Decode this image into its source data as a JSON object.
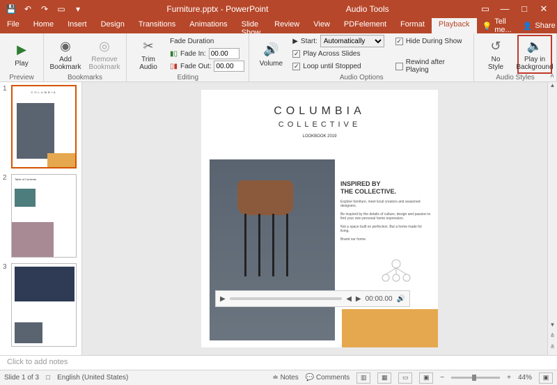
{
  "titlebar": {
    "doc_title": "Furniture.pptx - PowerPoint",
    "audio_tools": "Audio Tools"
  },
  "tabs": {
    "file": "File",
    "home": "Home",
    "insert": "Insert",
    "design": "Design",
    "transitions": "Transitions",
    "animations": "Animations",
    "slideshow": "Slide Show",
    "review": "Review",
    "view": "View",
    "pdfelement": "PDFelement",
    "format": "Format",
    "playback": "Playback",
    "tell_me": "Tell me...",
    "share": "Share"
  },
  "ribbon": {
    "preview": {
      "play": "Play",
      "group": "Preview"
    },
    "bookmarks": {
      "add": "Add\nBookmark",
      "remove": "Remove\nBookmark",
      "group": "Bookmarks"
    },
    "editing": {
      "trim": "Trim\nAudio",
      "fade_duration": "Fade Duration",
      "fade_in": "Fade In:",
      "fade_in_val": "00.00",
      "fade_out": "Fade Out:",
      "fade_out_val": "00.00",
      "group": "Editing"
    },
    "audio_options": {
      "volume": "Volume",
      "start": "Start:",
      "start_val": "Automatically",
      "play_across": "Play Across Slides",
      "loop": "Loop until Stopped",
      "hide": "Hide During Show",
      "rewind": "Rewind after Playing",
      "group": "Audio Options"
    },
    "audio_styles": {
      "no_style": "No\nStyle",
      "play_bg": "Play in\nBackground",
      "group": "Audio Styles"
    }
  },
  "slide": {
    "title": "COLUMBIA",
    "subtitle": "COLLECTIVE",
    "lookbook": "LOOKBOOK 2019",
    "heading1": "INSPIRED BY",
    "heading2": "THE COLLECTIVE.",
    "para1": "Explore furniture, meet local creators and seasoned designers.",
    "para2": "Be inspired by the details of culture, design and passion to find your own personal home expression.",
    "para3": "Not a space built on perfection. But a home made for living.",
    "para4": "Brand our home."
  },
  "player": {
    "time": "00:00.00"
  },
  "thumbs": {
    "n1": "1",
    "n2": "2",
    "n3": "3",
    "toc": "Table of Contents"
  },
  "notes": {
    "placeholder": "Click to add notes"
  },
  "status": {
    "slide_count": "Slide 1 of 3",
    "language": "English (United States)",
    "notes": "Notes",
    "comments": "Comments",
    "zoom": "44%"
  }
}
